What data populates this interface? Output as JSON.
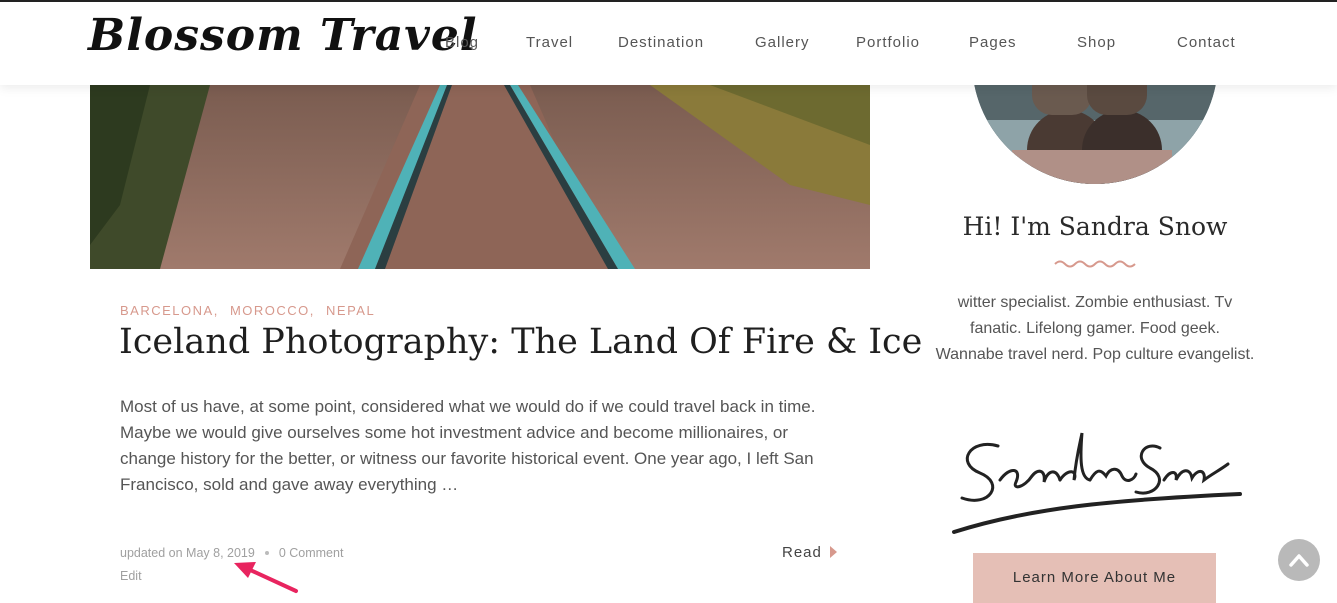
{
  "site": {
    "logo": "Blossom Travel"
  },
  "nav": [
    "Blog",
    "Travel",
    "Destination",
    "Gallery",
    "Portfolio",
    "Pages",
    "Shop",
    "Contact"
  ],
  "post": {
    "categories": [
      "BARCELONA,",
      "MOROCCO,",
      "NEPAL"
    ],
    "title": "Iceland Photography: The Land Of Fire & Ice",
    "excerpt": "Most of us have, at some point, considered what we would do if we could travel back in time. Maybe we would give ourselves some hot investment advice and become millionaires, or change history for the better, or witness our favorite historical event. One year ago, I left San Francisco, sold and gave away everything …",
    "updated": "updated on May 8, 2019",
    "comments": "0 Comment",
    "edit": "Edit",
    "read": "Read"
  },
  "sidebar": {
    "title": "Hi! I'm Sandra Snow",
    "bio": "witter specialist. Zombie enthusiast. Tv fanatic. Lifelong gamer. Food geek. Wannabe travel nerd. Pop culture evangelist.",
    "signature": "Sandra Snow",
    "button": "Learn More About Me"
  },
  "colors": {
    "accent": "#d7998d",
    "button_bg": "#e5bfb6",
    "annotation_arrow": "#e8245f"
  },
  "icons": {
    "read": "caret-right-icon",
    "scroll_top": "chevron-up-icon",
    "divider": "wave-icon"
  }
}
